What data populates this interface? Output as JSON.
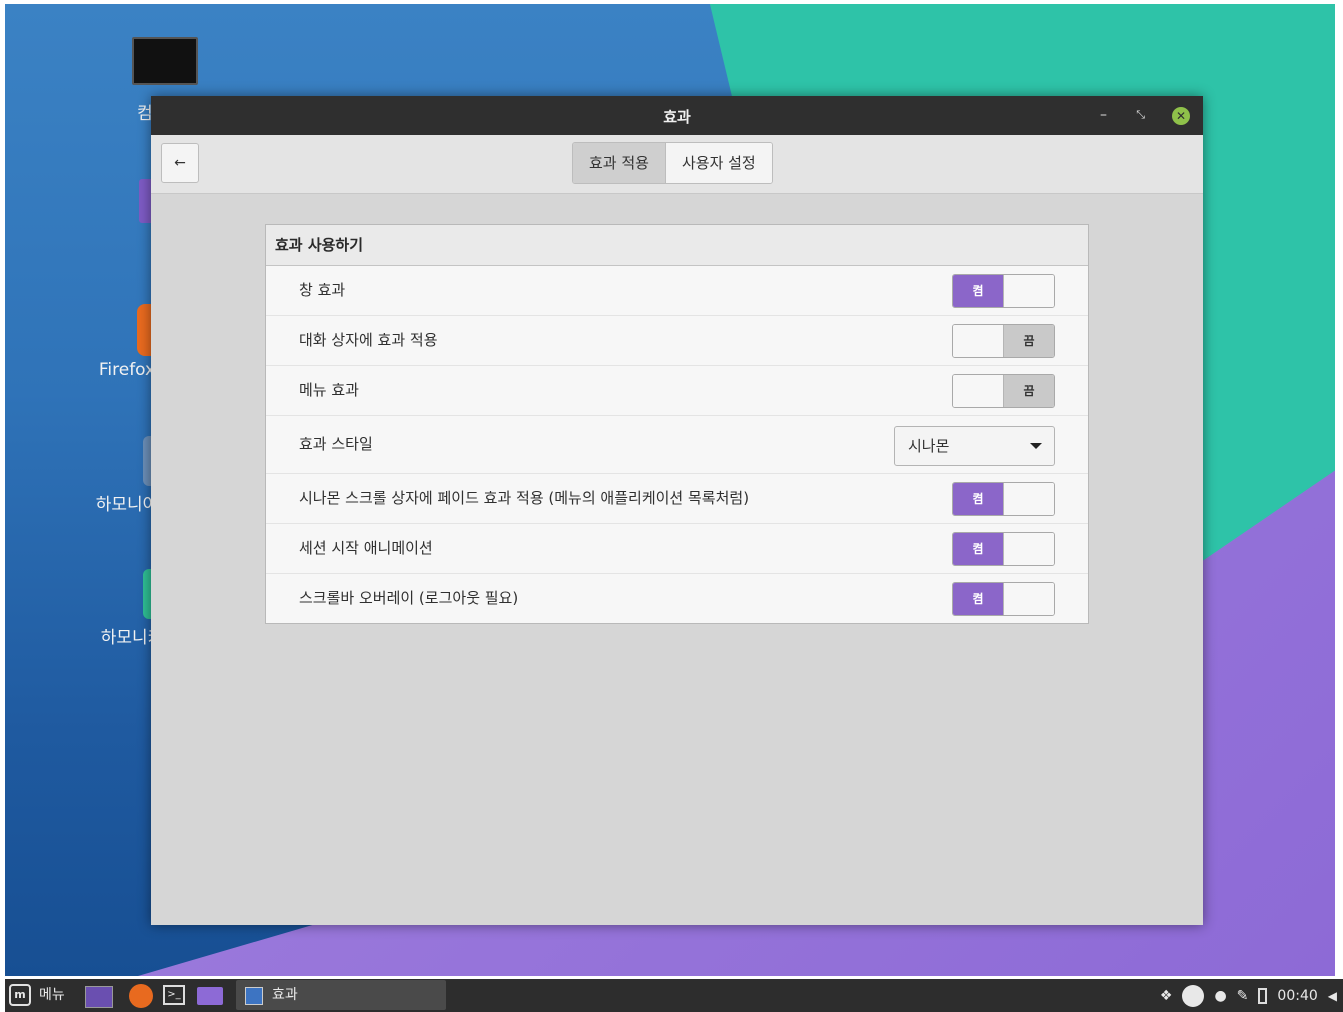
{
  "desktop": {
    "icons": [
      {
        "label": "컴"
      },
      {
        "label": ""
      },
      {
        "label": "Firefox"
      },
      {
        "label": "하모니아"
      },
      {
        "label": "하모니카"
      }
    ]
  },
  "window": {
    "title": "효과",
    "controls": {
      "minimize": "–",
      "restore": "⤡",
      "close": "✕"
    }
  },
  "toolbar": {
    "back_icon": "←",
    "tabs": [
      {
        "label": "효과 적용",
        "active": true
      },
      {
        "label": "사용자 설정",
        "active": false
      }
    ]
  },
  "section": {
    "title": "효과 사용하기",
    "rows": [
      {
        "label": "창 효과",
        "type": "switch",
        "state": "on",
        "on_text": "켬",
        "off_text": "끔"
      },
      {
        "label": "대화 상자에 효과 적용",
        "type": "switch",
        "state": "off",
        "on_text": "켬",
        "off_text": "끔"
      },
      {
        "label": "메뉴 효과",
        "type": "switch",
        "state": "off",
        "on_text": "켬",
        "off_text": "끔"
      },
      {
        "label": "효과 스타일",
        "type": "combo",
        "value": "시나몬"
      },
      {
        "label": "시나몬 스크롤 상자에 페이드 효과 적용 (메뉴의 애플리케이션 목록처럼)",
        "type": "switch",
        "state": "on",
        "on_text": "켬",
        "off_text": "끔"
      },
      {
        "label": "세션 시작 애니메이션",
        "type": "switch",
        "state": "on",
        "on_text": "켬",
        "off_text": "끔"
      },
      {
        "label": "스크롤바 오버레이 (로그아웃 필요)",
        "type": "switch",
        "state": "on",
        "on_text": "켬",
        "off_text": "끔"
      }
    ]
  },
  "panel": {
    "menu_label": "메뉴",
    "task_label": "효과",
    "clock": "00:40",
    "accent": "#8b66c9"
  }
}
